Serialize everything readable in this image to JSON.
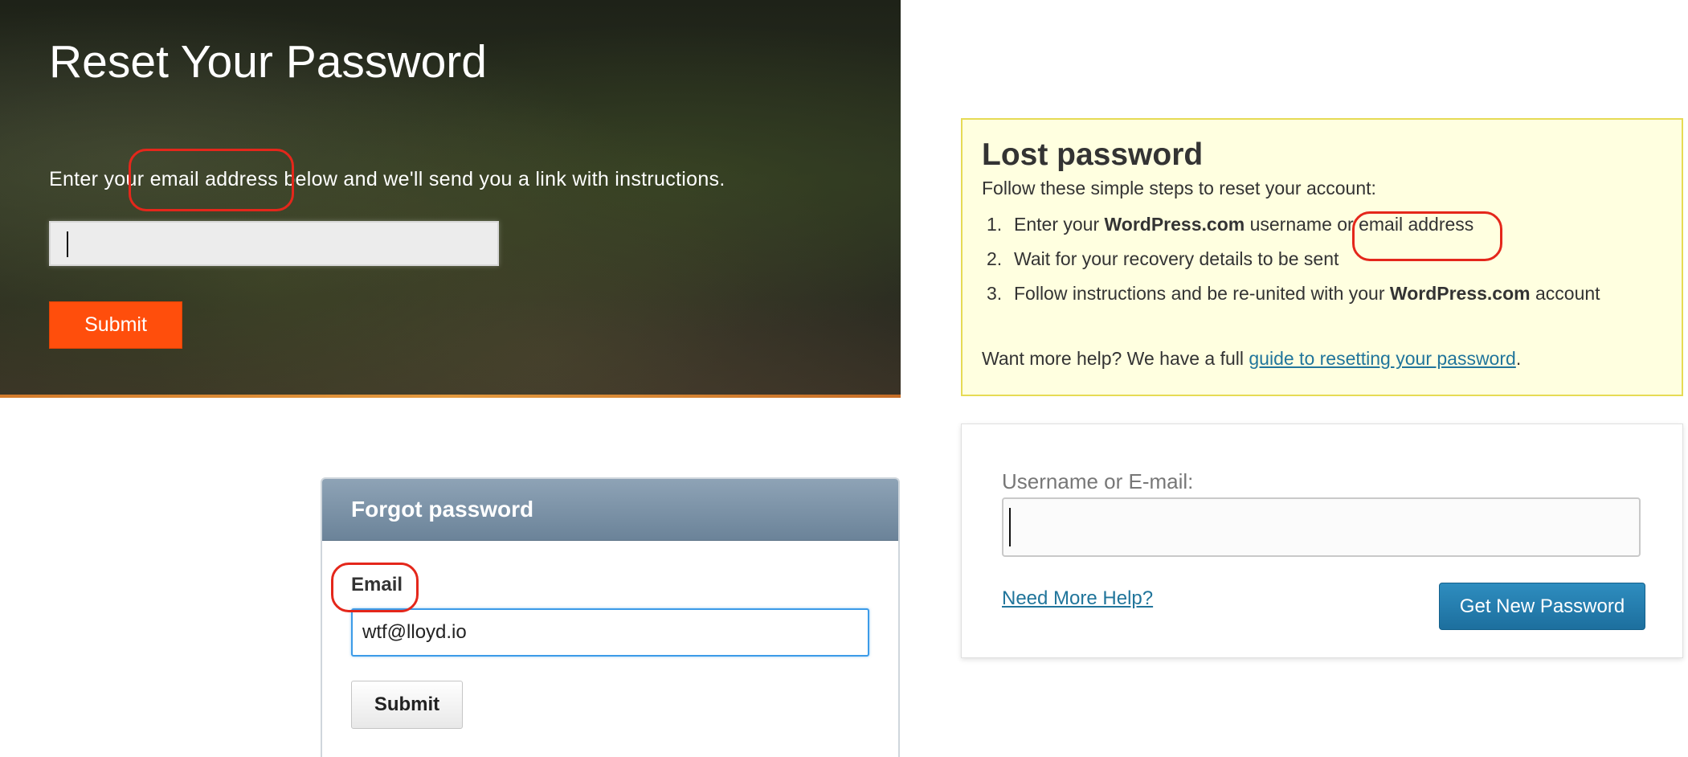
{
  "reset": {
    "title": "Reset Your Password",
    "instructions": "Enter your email address below and we'll send you a link with instructions.",
    "email_value": "",
    "submit_label": "Submit",
    "colors": {
      "accent": "#ff4e0c",
      "highlight": "#e4271b"
    }
  },
  "lost": {
    "title": "Lost password",
    "subtitle": "Follow these simple steps to reset your account:",
    "steps": [
      {
        "num": "1.",
        "a": "Enter your ",
        "b": "WordPress.com",
        "c": " username or email address",
        "d": ""
      },
      {
        "num": "2.",
        "a": "Wait for your recovery details to be sent",
        "b": "",
        "c": "",
        "d": ""
      },
      {
        "num": "3.",
        "a": "Follow instructions and be re-united with your ",
        "b": "WordPress.com",
        "c": " account",
        "d": ""
      }
    ],
    "help_prefix": "Want more help? We have a full ",
    "help_link": "guide to resetting your password",
    "help_suffix": ".",
    "colors": {
      "background": "#ffffe0",
      "border": "#e6db55",
      "link": "#21759b"
    }
  },
  "username_form": {
    "label": "Username or E-mail:",
    "value": "",
    "help_link": "Need More Help?",
    "button_label": "Get New Password",
    "colors": {
      "button": "#1d6f9e"
    }
  },
  "forgot": {
    "title": "Forgot password",
    "email_label": "Email",
    "email_value": "wtf@lloyd.io",
    "submit_label": "Submit",
    "colors": {
      "header": "#6b8399",
      "focus": "#3c9be8"
    }
  }
}
